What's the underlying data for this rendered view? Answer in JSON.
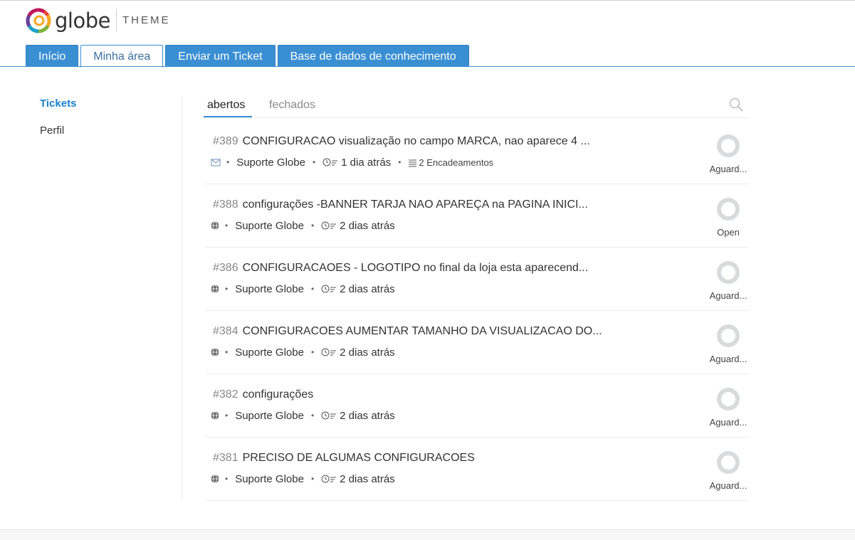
{
  "brand": {
    "word": "globe",
    "theme": "THEME"
  },
  "tabs": [
    {
      "label": "Início"
    },
    {
      "label": "Minha área"
    },
    {
      "label": "Enviar um Ticket"
    },
    {
      "label": "Base de dados de conhecimento"
    }
  ],
  "active_tab": "Minha área",
  "sidenav": {
    "items": [
      {
        "label": "Tickets"
      },
      {
        "label": "Perfil"
      }
    ],
    "active": "Tickets"
  },
  "subtabs": {
    "open": "abertos",
    "closed": "fechados",
    "active": "abertos"
  },
  "tickets": [
    {
      "number": "#389",
      "title": "CONFIGURACAO visualização no campo MARCA, nao aparece 4 ...",
      "source_icon": "email-icon",
      "team": "Suporte Globe",
      "time": "1 dia atrás",
      "threads": "2 Encadeamentos",
      "status": "Aguard..."
    },
    {
      "number": "#388",
      "title": "configurações -BANNER TARJA NAO APAREÇA na PAGINA INICI...",
      "source_icon": "globe-icon",
      "team": "Suporte Globe",
      "time": "2 dias atrás",
      "threads": "",
      "status": "Open"
    },
    {
      "number": "#386",
      "title": "CONFIGURACAOES - LOGOTIPO no final da loja esta aparecend...",
      "source_icon": "globe-icon",
      "team": "Suporte Globe",
      "time": "2 dias atrás",
      "threads": "",
      "status": "Aguard..."
    },
    {
      "number": "#384",
      "title": "CONFIGURACOES AUMENTAR TAMANHO DA VISUALIZACAO DO...",
      "source_icon": "globe-icon",
      "team": "Suporte Globe",
      "time": "2 dias atrás",
      "threads": "",
      "status": "Aguard..."
    },
    {
      "number": "#382",
      "title": "configurações",
      "source_icon": "globe-icon",
      "team": "Suporte Globe",
      "time": "2 dias atrás",
      "threads": "",
      "status": "Aguard..."
    },
    {
      "number": "#381",
      "title": "PRECISO DE ALGUMAS CONFIGURACOES",
      "source_icon": "globe-icon",
      "team": "Suporte Globe",
      "time": "2 dias atrás",
      "threads": "",
      "status": "Aguard..."
    }
  ],
  "colors": {
    "accent": "#3a8fd3",
    "active_link": "#1a82c8"
  }
}
